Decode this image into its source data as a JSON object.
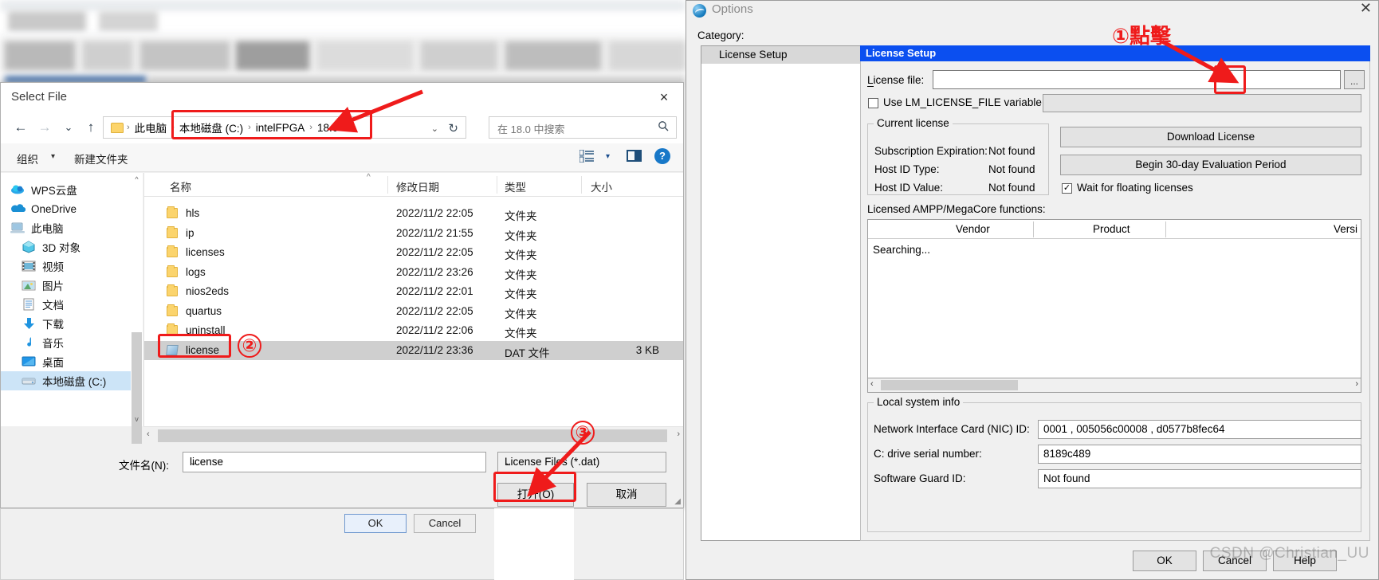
{
  "select_file_dialog": {
    "title": "Select File",
    "close_icon": "×",
    "nav": {
      "back_icon": "←",
      "forward_icon": "→",
      "recent_icon": "⌄",
      "up_icon": "↑",
      "breadcrumbs": [
        "此电脑",
        "本地磁盘 (C:)",
        "intelFPGA",
        "18.0"
      ],
      "separator": "›",
      "dropdown_caret": "⌄",
      "refresh_icon": "↻",
      "search_placeholder": "在 18.0 中搜索",
      "search_icon": "🔍"
    },
    "toolbar": {
      "organize": "组织",
      "organize_caret": "▾",
      "new_folder": "新建文件夹",
      "view_caret": "▾",
      "help_icon": "?"
    },
    "sidebar": [
      {
        "label": "WPS云盘",
        "icon": "wps-cloud-icon",
        "level": 1,
        "selected": false
      },
      {
        "label": "OneDrive",
        "icon": "onedrive-icon",
        "level": 1,
        "selected": false
      },
      {
        "label": "此电脑",
        "icon": "this-pc-icon",
        "level": 1,
        "selected": false
      },
      {
        "label": "3D 对象",
        "icon": "3d-objects-icon",
        "level": 2,
        "selected": false
      },
      {
        "label": "视频",
        "icon": "videos-icon",
        "level": 2,
        "selected": false
      },
      {
        "label": "图片",
        "icon": "pictures-icon",
        "level": 2,
        "selected": false
      },
      {
        "label": "文档",
        "icon": "documents-icon",
        "level": 2,
        "selected": false
      },
      {
        "label": "下载",
        "icon": "downloads-icon",
        "level": 2,
        "selected": false
      },
      {
        "label": "音乐",
        "icon": "music-icon",
        "level": 2,
        "selected": false
      },
      {
        "label": "桌面",
        "icon": "desktop-icon",
        "level": 2,
        "selected": false
      },
      {
        "label": "本地磁盘 (C:)",
        "icon": "drive-icon",
        "level": 2,
        "selected": true
      }
    ],
    "sidebar_scroll": {
      "up_icon": "^",
      "down_icon": "v"
    },
    "file_list": {
      "columns": [
        "名称",
        "修改日期",
        "类型",
        "大小"
      ],
      "sort_mark": "^",
      "rows": [
        {
          "name": "hls",
          "date": "2022/11/2 22:05",
          "type": "文件夹",
          "size": "",
          "icon": "folder",
          "selected": false
        },
        {
          "name": "ip",
          "date": "2022/11/2 21:55",
          "type": "文件夹",
          "size": "",
          "icon": "folder",
          "selected": false
        },
        {
          "name": "licenses",
          "date": "2022/11/2 22:05",
          "type": "文件夹",
          "size": "",
          "icon": "folder",
          "selected": false
        },
        {
          "name": "logs",
          "date": "2022/11/2 23:26",
          "type": "文件夹",
          "size": "",
          "icon": "folder",
          "selected": false
        },
        {
          "name": "nios2eds",
          "date": "2022/11/2 22:01",
          "type": "文件夹",
          "size": "",
          "icon": "folder",
          "selected": false
        },
        {
          "name": "quartus",
          "date": "2022/11/2 22:05",
          "type": "文件夹",
          "size": "",
          "icon": "folder",
          "selected": false
        },
        {
          "name": "uninstall",
          "date": "2022/11/2 22:06",
          "type": "文件夹",
          "size": "",
          "icon": "folder",
          "selected": false
        },
        {
          "name": "license",
          "date": "2022/11/2 23:36",
          "type": "DAT 文件",
          "size": "3 KB",
          "icon": "dat",
          "selected": true
        }
      ],
      "hscroll": {
        "left_icon": "‹",
        "right_icon": "›"
      }
    },
    "bottom": {
      "filename_label": "文件名(N):",
      "filename_value": "license",
      "filter_value": "License Files (*.dat)",
      "caret": "⌄",
      "open_button": "打开(O)",
      "cancel_button": "取消"
    },
    "behind_dialog": {
      "ok": "OK",
      "cancel": "Cancel"
    }
  },
  "options_window": {
    "title": "Options",
    "close_icon": "✕",
    "category_label": "Category:",
    "category_items": [
      "License Setup"
    ],
    "panel": {
      "header": "License Setup",
      "license_file_label": "License file:",
      "license_file_value": "",
      "browse_button": "...",
      "lm_checkbox_label": "Use LM_LICENSE_FILE variable:",
      "lm_checkbox_checked": false,
      "lm_value": "",
      "current_license": {
        "group_label": "Current license",
        "rows": [
          {
            "label": "Subscription Expiration:",
            "value": "Not found"
          },
          {
            "label": "Host ID Type:",
            "value": "Not found"
          },
          {
            "label": "Host ID Value:",
            "value": "Not found"
          }
        ]
      },
      "download_button": "Download License",
      "evaluation_button": "Begin 30-day Evaluation Period",
      "wait_checkbox_label": "Wait for floating licenses",
      "wait_checkbox_checked": true,
      "wait_check_glyph": "✓",
      "ampp_label": "Licensed AMPP/MegaCore functions:",
      "ampp_columns": [
        "Vendor",
        "Product",
        "Versi"
      ],
      "ampp_empty_text": "Searching...",
      "ampp_hscroll": {
        "left_icon": "‹",
        "right_icon": "›"
      },
      "local_system_info": {
        "group_label": "Local system info",
        "rows": [
          {
            "label": "Network Interface Card (NIC) ID:",
            "value": "0001 , 005056c00008 , d0577b8fec64"
          },
          {
            "label": "C: drive serial number:",
            "value": "8189c489"
          },
          {
            "label": "Software Guard ID:",
            "value": "Not found"
          }
        ]
      }
    },
    "footer": {
      "ok": "OK",
      "cancel": "Cancel",
      "help": "Help"
    }
  },
  "annotations": {
    "step1_number": "①",
    "step1_text": "點擊",
    "step2_number": "②",
    "step3_number": "③",
    "accent_color": "#ef1b1b"
  },
  "watermark": "CSDN @Christian_UU"
}
